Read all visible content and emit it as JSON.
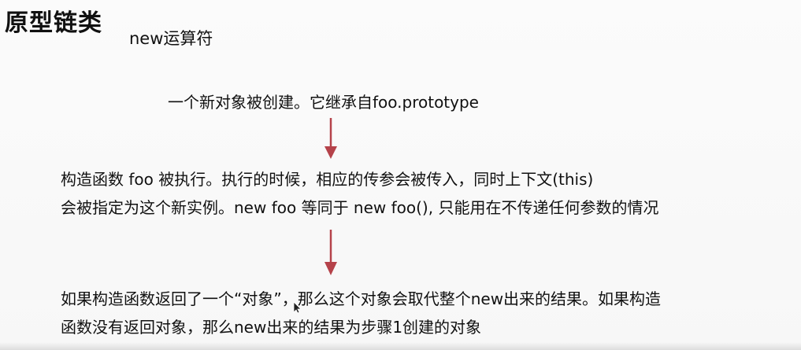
{
  "header": {
    "title": "原型链类",
    "subtitle": "new运算符"
  },
  "steps": [
    {
      "lines": [
        "一个新对象被创建。它继承自foo.prototype"
      ]
    },
    {
      "lines": [
        "构造函数 foo 被执行。执行的时候，相应的传参会被传入，同时上下文(this)",
        "会被指定为这个新实例。new foo 等同于 new foo(), 只能用在不传递任何参数的情况"
      ]
    },
    {
      "lines": [
        "如果构造函数返回了一个“对象”，那么这个对象会取代整个new出来的结果。如果构造",
        "函数没有返回对象，那么new出来的结果为步骤1创建的对象"
      ]
    }
  ],
  "icons": {
    "arrow_1": "down-arrow-icon",
    "arrow_2": "down-arrow-icon",
    "cursor": "mouse-cursor-icon"
  },
  "colors": {
    "text": "#111111",
    "arrow": "#b5424a",
    "background": "#f8f8f8"
  }
}
